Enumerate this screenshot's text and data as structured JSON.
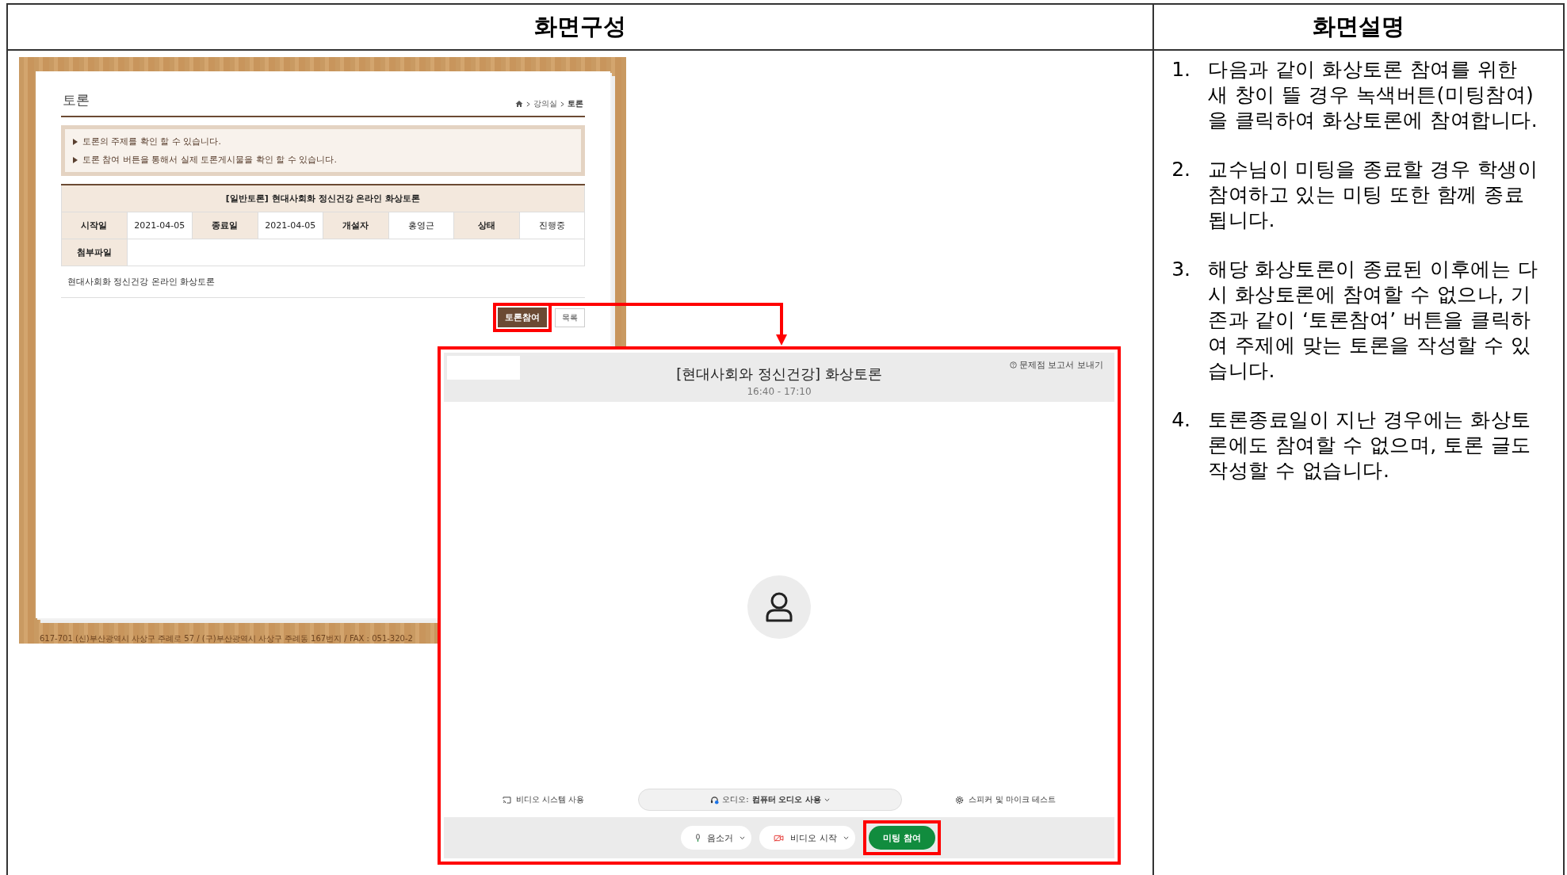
{
  "header": {
    "left": "화면구성",
    "right": "화면설명"
  },
  "site": {
    "title": "토론",
    "breadcrumb": [
      "강의실",
      "토론"
    ],
    "notices": [
      "토론의 주제를 확인 할 수 있습니다.",
      "토론 참여 버튼을 통해서 실제 토론게시물을 확인 할 수 있습니다."
    ],
    "board_title": "[일반토론] 현대사회화 정신건강 온라인 화상토론",
    "fields": [
      {
        "label": "시작일",
        "value": "2021-04-05"
      },
      {
        "label": "종료일",
        "value": "2021-04-05"
      },
      {
        "label": "개설자",
        "value": "홍영근"
      },
      {
        "label": "상태",
        "value": "진행중"
      }
    ],
    "attachment_label": "첨부파일",
    "body": "현대사회화 정신건강 온라인 화상토론",
    "buttons": [
      {
        "label": "토론참여",
        "kind": "primary",
        "highlighted": true
      },
      {
        "label": "목록",
        "kind": "secondary",
        "highlighted": false
      }
    ],
    "footer": "617-701 (신)부산광역시 사상구 주례로 57 / (구)부산광역시 사상구 주례동 167번지 / FAX : 051-320-2"
  },
  "meeting": {
    "report_link": "문제점 보고서 보내기",
    "title": "[현대사회와 정신건강] 화상토론",
    "time": "16:40 - 17:10",
    "options": [
      {
        "label": "비디오 시스템 사용",
        "kind": "cast"
      },
      {
        "label": "오디오: ",
        "value": "컴퓨터 오디오 사용",
        "kind": "audio"
      },
      {
        "label": "스피커 및 마이크 테스트",
        "kind": "settings"
      }
    ],
    "controls": [
      {
        "label": "음소거",
        "kind": "mic"
      },
      {
        "label": "비디오 시작",
        "kind": "video"
      }
    ],
    "join_button": {
      "label": "미팅 참여",
      "highlighted": true
    }
  },
  "steps": [
    {
      "number": "1.",
      "text": "다음과 같이 화상토론 참여를 위한 새 창이 뜰 경우 녹색버튼(미팅참여)을 클릭하여 화상토론에 참여합니다."
    },
    {
      "number": "2.",
      "text": "교수님이 미팅을 종료할 경우 학생이 참여하고 있는 미팅 또한 함께 종료됩니다."
    },
    {
      "number": "3.",
      "text": "해당 화상토론이 종료된 이후에는 다시 화상토론에 참여할 수 없으나, 기존과 같이 ‘토론참여’ 버튼을 클릭하여 주제에 맞는 토론을 작성할 수 있습니다."
    },
    {
      "number": "4.",
      "text": "토론종료일이 지난 경우에는 화상토론에도 참여할 수 없으며, 토론 글도 작성할 수 없습니다."
    }
  ]
}
